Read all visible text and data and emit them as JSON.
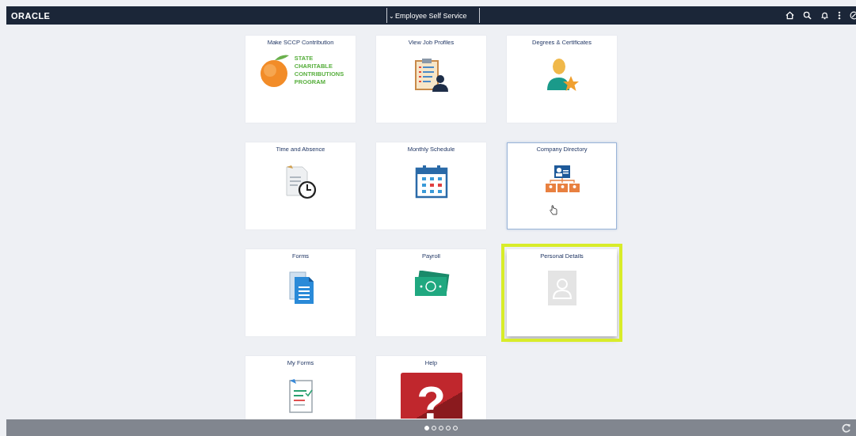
{
  "header": {
    "logo": "ORACLE",
    "title": "Employee Self Service",
    "caret": "⌄"
  },
  "tiles": [
    {
      "title": "Make SCCP Contribution",
      "kind": "sccp",
      "logo_lines": [
        "STATE",
        "CHARITABLE",
        "CONTRIBUTIONS",
        "PROGRAM"
      ],
      "focused": false,
      "highlighted": false,
      "hovered": false
    },
    {
      "title": "View Job Profiles",
      "kind": "clipboard",
      "focused": false,
      "highlighted": false,
      "hovered": false
    },
    {
      "title": "Degrees & Certificates",
      "kind": "person-star",
      "focused": false,
      "highlighted": false,
      "hovered": false
    },
    {
      "title": "Time and Absence",
      "kind": "doc-clock",
      "focused": false,
      "highlighted": false,
      "hovered": false
    },
    {
      "title": "Monthly Schedule",
      "kind": "calendar",
      "focused": false,
      "highlighted": false,
      "hovered": false
    },
    {
      "title": "Company Directory",
      "kind": "org-chart",
      "focused": true,
      "highlighted": false,
      "hovered": true
    },
    {
      "title": "Forms",
      "kind": "forms",
      "focused": false,
      "highlighted": false,
      "hovered": false
    },
    {
      "title": "Payroll",
      "kind": "money",
      "focused": false,
      "highlighted": false,
      "hovered": false
    },
    {
      "title": "Personal Details",
      "kind": "photo",
      "focused": false,
      "highlighted": true,
      "hovered": false
    },
    {
      "title": "My Forms",
      "kind": "form-check",
      "focused": false,
      "highlighted": false,
      "hovered": false
    },
    {
      "title": "Help",
      "kind": "help",
      "glyph": "?",
      "focused": false,
      "highlighted": false,
      "hovered": false
    }
  ],
  "pages": [
    {
      "selected": true
    },
    {
      "selected": false
    },
    {
      "selected": false
    },
    {
      "selected": false
    },
    {
      "selected": false
    }
  ]
}
